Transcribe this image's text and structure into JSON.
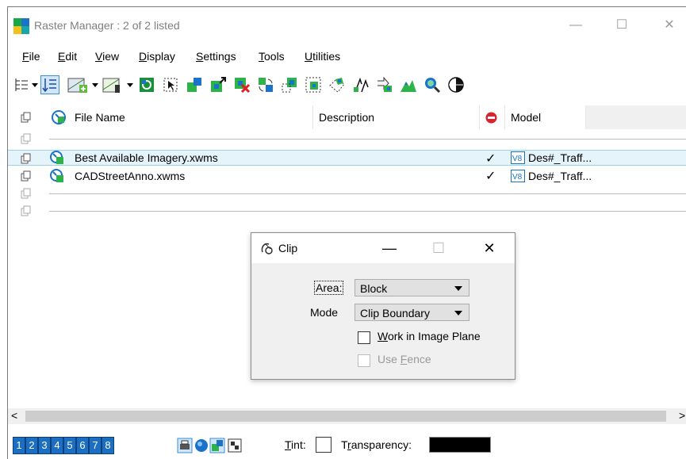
{
  "window": {
    "title": "Raster Manager : 2 of 2 listed",
    "minimize": "—",
    "maximize": "☐",
    "close": "✕"
  },
  "menu": [
    {
      "label": "File",
      "accel": "F",
      "rest": "ile"
    },
    {
      "label": "Edit",
      "accel": "E",
      "rest": "dit"
    },
    {
      "label": "View",
      "accel": "V",
      "rest": "iew"
    },
    {
      "label": "Display",
      "accel": "D",
      "rest": "isplay"
    },
    {
      "label": "Settings",
      "accel": "S",
      "rest": "ettings"
    },
    {
      "label": "Tools",
      "accel": "T",
      "rest": "ools"
    },
    {
      "label": "Utilities",
      "accel": "U",
      "rest": "tilities"
    }
  ],
  "grid": {
    "headers": {
      "file_name": "File Name",
      "description": "Description",
      "model": "Model"
    },
    "rows": [
      {
        "file_name": "Best Available Imagery.xwms",
        "check": "✓",
        "model": "Des#_Traff..."
      },
      {
        "file_name": "CADStreetAnno.xwms",
        "check": "✓",
        "model": "Des#_Traff..."
      }
    ]
  },
  "scroll": {
    "left": "<",
    "right": ">"
  },
  "status": {
    "views": [
      "1",
      "2",
      "3",
      "4",
      "5",
      "6",
      "7",
      "8"
    ],
    "tint_label": "Tint:",
    "tint_accel": "T",
    "tint_rest": "int:",
    "transparency_label": "Transparency:",
    "transparency_accel": "r",
    "transparency_pre": "T",
    "transparency_rest": "ansparency:"
  },
  "dialog": {
    "title": "Clip",
    "minimize": "—",
    "maximize": "☐",
    "close": "✕",
    "area_label": "Area:",
    "area_value": "Block",
    "mode_label": "Mode",
    "mode_value": "Clip Boundary",
    "work_in_plane": {
      "accel": "W",
      "rest": "ork in Image Plane"
    },
    "use_fence": {
      "pre": "Use ",
      "accel": "F",
      "rest": "ence"
    }
  }
}
